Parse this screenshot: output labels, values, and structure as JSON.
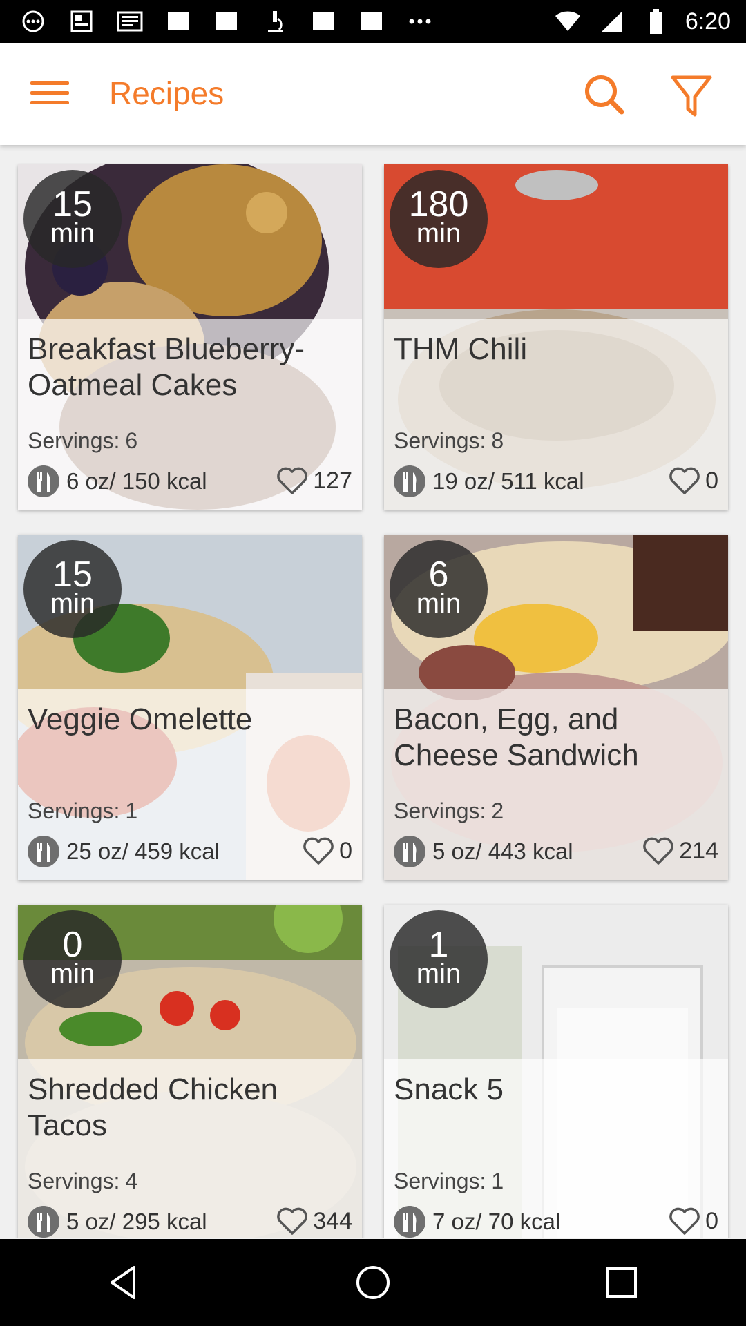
{
  "status_bar": {
    "time": "6:20",
    "icons": [
      "whatsapp-icon",
      "news-icon",
      "news-icon",
      "image-icon",
      "image-icon",
      "microscope-icon",
      "image-icon",
      "image-icon",
      "more-dots-icon",
      "wifi-icon",
      "signal-icon",
      "battery-icon"
    ]
  },
  "app_bar": {
    "title": "Recipes",
    "accent_color": "#F47B2A"
  },
  "recipes": [
    {
      "time": "15",
      "unit": "min",
      "title": "Breakfast Blueberry-Oatmeal Cakes",
      "servings_label": "Servings:",
      "servings": "6",
      "portion": "6 oz/ 150 kcal",
      "likes": "127"
    },
    {
      "time": "180",
      "unit": "min",
      "title": "THM Chili",
      "servings_label": "Servings:",
      "servings": "8",
      "portion": "19 oz/ 511 kcal",
      "likes": "0"
    },
    {
      "time": "15",
      "unit": "min",
      "title": "Veggie Omelette",
      "servings_label": "Servings:",
      "servings": "1",
      "portion": "25 oz/ 459 kcal",
      "likes": "0"
    },
    {
      "time": "6",
      "unit": "min",
      "title": "Bacon, Egg, and Cheese Sandwich",
      "servings_label": "Servings:",
      "servings": "2",
      "portion": "5 oz/ 443 kcal",
      "likes": "214"
    },
    {
      "time": "0",
      "unit": "min",
      "title": "Shredded Chicken Tacos",
      "servings_label": "Servings:",
      "servings": "4",
      "portion": "5 oz/ 295 kcal",
      "likes": "344"
    },
    {
      "time": "1",
      "unit": "min",
      "title": "Snack 5",
      "servings_label": "Servings:",
      "servings": "1",
      "portion": "7 oz/ 70 kcal",
      "likes": "0"
    }
  ]
}
